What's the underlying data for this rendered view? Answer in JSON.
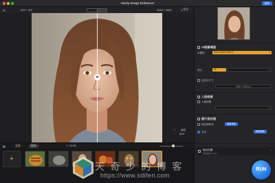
{
  "window": {
    "title": "Aiarty Image Enhancer",
    "login_label": "登录"
  },
  "toolbar": {
    "source_size": "920 * 920",
    "output_size": "3680 * 3680",
    "right_label": "预览",
    "left_icon": "sidebar-icon",
    "right_icon": "export-icon"
  },
  "canvas": {
    "split_handle_glyph": "◂▸",
    "zoom_percent": "50%",
    "zoom_plus": "+",
    "zoom_minus": "−",
    "fit_label": "适应"
  },
  "filmstrip": {
    "tab_all": "全部",
    "tab_selected": "图库",
    "counter": "1 / 32/35",
    "add_glyph": "+",
    "thumbs": [
      "tiger",
      "wolf",
      "girl",
      "food",
      "owl",
      "portrait"
    ]
  },
  "panel": {
    "ai_section": "AI图像增强",
    "model_label": "AI模型",
    "model_value": "More-Detail GAN v2",
    "scale_label": "放大",
    "scale_value": "4X",
    "custom_size_label": "自定义尺寸",
    "custom_size_value": "3680 * 3680 px",
    "face_section": "人脸修复",
    "face_check_label": "人脸修复",
    "batch_section": "图片批处理",
    "batch_check_label": "批处理所有",
    "batch_add_label": "批量添加",
    "file_label": "文件",
    "batch_btn_label": "批量处理",
    "output_label": "输出设置",
    "output_sub": "输出格式: PNG",
    "run_label": "RUN"
  },
  "watermark": {
    "text": "天 奇 少 的 博 客",
    "url": "https://www.sdifen.com"
  },
  "colors": {
    "accent_orange": "#e7a22f",
    "accent_blue": "#2f6fe0",
    "panel_bg": "#252528"
  }
}
